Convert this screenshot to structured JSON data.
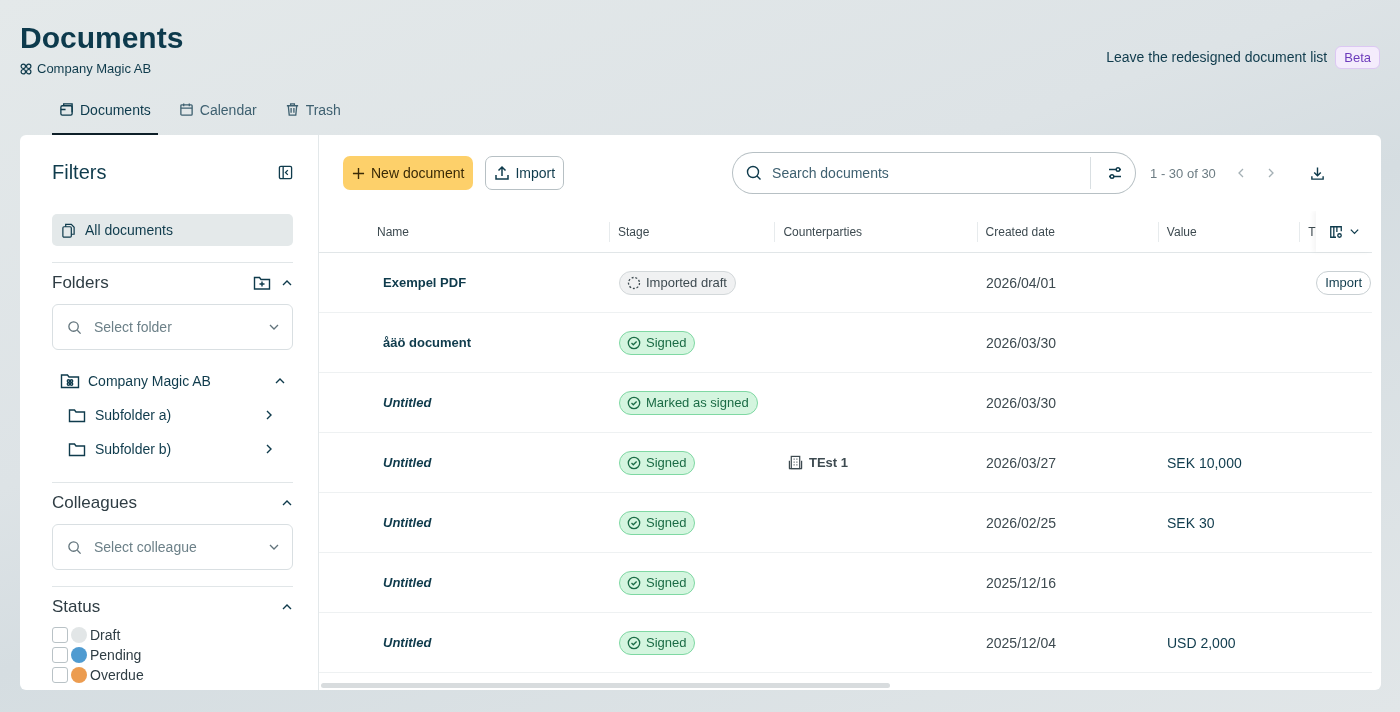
{
  "page": {
    "title": "Documents",
    "company": "Company Magic AB",
    "leave_link": "Leave the redesigned document list",
    "badge": "Beta"
  },
  "tabs": [
    {
      "label": "Documents",
      "selected": true
    },
    {
      "label": "Calendar",
      "selected": false
    },
    {
      "label": "Trash",
      "selected": false
    }
  ],
  "filters": {
    "title": "Filters",
    "all_documents": {
      "label": "All documents",
      "selected": true
    },
    "folders": {
      "title": "Folders",
      "expanded": true,
      "placeholder": "Select folder",
      "tree": [
        {
          "label": "Company Magic AB",
          "expanded": true,
          "children": [
            {
              "label": "Subfolder a)",
              "expanded": false
            },
            {
              "label": "Subfolder b)",
              "expanded": false
            }
          ]
        }
      ]
    },
    "colleagues": {
      "title": "Colleagues",
      "expanded": true,
      "placeholder": "Select colleague"
    },
    "status": {
      "title": "Status",
      "expanded": true,
      "items": [
        {
          "label": "Draft",
          "checked": false,
          "color": "#e2e6e7"
        },
        {
          "label": "Pending",
          "checked": false,
          "color": "#4f9bd1"
        },
        {
          "label": "Overdue",
          "checked": false,
          "color": "#ec9c50"
        }
      ]
    }
  },
  "toolbar": {
    "new_document": "New document",
    "import": "Import",
    "search_placeholder": "Search documents",
    "pagination": "1 - 30 of 30"
  },
  "table": {
    "columns": [
      "Name",
      "Stage",
      "Counterparties",
      "Created date",
      "Value",
      "T"
    ],
    "rows": [
      {
        "name": "Exempel PDF",
        "untitled": false,
        "stage": {
          "kind": "imported",
          "label": "Imported draft"
        },
        "counterparty": "",
        "created": "2026/04/01",
        "value": "",
        "action": "Import"
      },
      {
        "name": "åäö document",
        "untitled": false,
        "stage": {
          "kind": "signed",
          "label": "Signed"
        },
        "counterparty": "",
        "created": "2026/03/30",
        "value": "",
        "action": ""
      },
      {
        "name": "Untitled",
        "untitled": true,
        "stage": {
          "kind": "signed",
          "label": "Marked as signed"
        },
        "counterparty": "",
        "created": "2026/03/30",
        "value": "",
        "action": ""
      },
      {
        "name": "Untitled",
        "untitled": true,
        "stage": {
          "kind": "signed",
          "label": "Signed"
        },
        "counterparty": "TEst 1",
        "created": "2026/03/27",
        "value": "SEK 10,000",
        "action": ""
      },
      {
        "name": "Untitled",
        "untitled": true,
        "stage": {
          "kind": "signed",
          "label": "Signed"
        },
        "counterparty": "",
        "created": "2026/02/25",
        "value": "SEK 30",
        "action": ""
      },
      {
        "name": "Untitled",
        "untitled": true,
        "stage": {
          "kind": "signed",
          "label": "Signed"
        },
        "counterparty": "",
        "created": "2025/12/16",
        "value": "",
        "action": ""
      },
      {
        "name": "Untitled",
        "untitled": true,
        "stage": {
          "kind": "signed",
          "label": "Signed"
        },
        "counterparty": "",
        "created": "2025/12/04",
        "value": "USD 2,000",
        "action": ""
      }
    ]
  }
}
